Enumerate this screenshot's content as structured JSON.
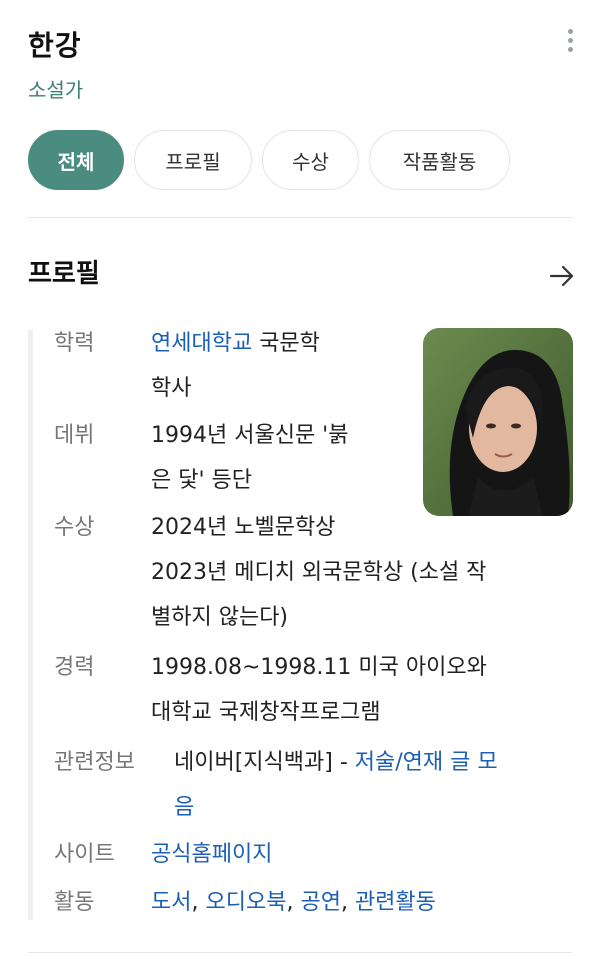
{
  "header": {
    "title": "한강",
    "subtitle": "소설가"
  },
  "tabs": [
    {
      "label": "전체",
      "active": true
    },
    {
      "label": "프로필",
      "active": false
    },
    {
      "label": "수상",
      "active": false
    },
    {
      "label": "작품활동",
      "active": false
    }
  ],
  "profile": {
    "section_title": "프로필",
    "education": {
      "label": "학력",
      "link": "연세대학교",
      "text1": " 국문학",
      "line2": "학사"
    },
    "debut": {
      "label": "데뷔",
      "line1": "1994년 서울신문 '붉",
      "line2": "은 닻' 등단"
    },
    "awards": {
      "label": "수상",
      "line1": "2024년 노벨문학상",
      "line2": "2023년 메디치 외국문학상 (소설 작",
      "line3": "별하지 않는다)"
    },
    "career": {
      "label": "경력",
      "line1": "1998.08~1998.11 미국 아이오와",
      "line2": "대학교 국제창작프로그램"
    },
    "related": {
      "label": "관련정보",
      "text": "네이버[지식백과] - ",
      "link1": "저술/연재 글 모",
      "link2": "음"
    },
    "site": {
      "label": "사이트",
      "link": "공식홈페이지"
    },
    "activity": {
      "label": "활동",
      "link1": "도서",
      "sep1": ", ",
      "link2": "오디오북",
      "sep2": ", ",
      "link3": "공연",
      "sep3": ", ",
      "link4": "관련활동"
    }
  },
  "colors": {
    "accent": "#4a8c80",
    "link": "#1c5fb5",
    "label": "#777777"
  },
  "icons": {
    "more": "more-vertical-icon",
    "arrow": "arrow-right-icon"
  }
}
